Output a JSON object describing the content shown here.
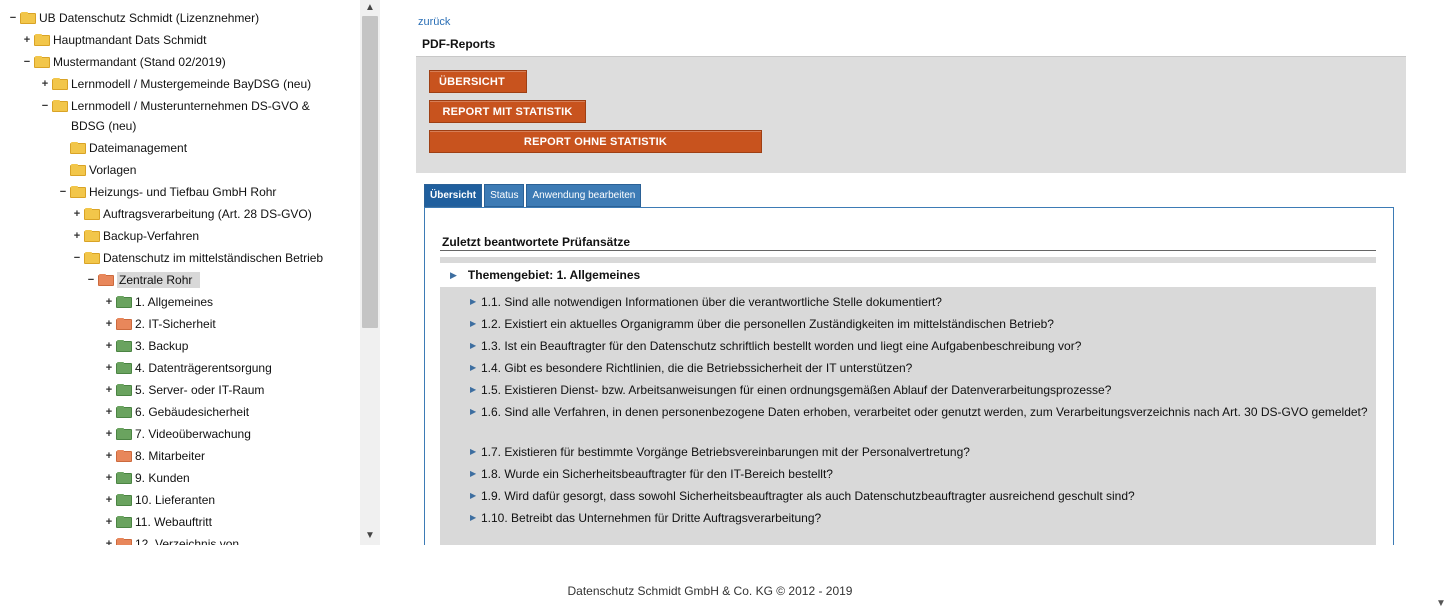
{
  "tree": {
    "items": [
      {
        "toggle": "−",
        "folder": "yellow",
        "label": "UB Datenschutz Schmidt (Lizenznehmer)"
      },
      {
        "toggle": "+",
        "folder": "yellow",
        "label": "Hauptmandant Dats Schmidt"
      },
      {
        "toggle": "−",
        "folder": "yellow",
        "label": "Mustermandant (Stand 02/2019)"
      },
      {
        "toggle": "+",
        "folder": "yellow",
        "label": "Lernmodell / Mustergemeinde BayDSG (neu)"
      },
      {
        "toggle": "−",
        "folder": "yellow",
        "label": "Lernmodell / Musterunternehmen DS-GVO & BDSG (neu)"
      },
      {
        "toggle": "",
        "folder": "yellow",
        "label": "Dateimanagement"
      },
      {
        "toggle": "",
        "folder": "yellow",
        "label": "Vorlagen"
      },
      {
        "toggle": "−",
        "folder": "yellow",
        "label": "Heizungs- und Tiefbau GmbH Rohr"
      },
      {
        "toggle": "+",
        "folder": "yellow",
        "label": "Auftragsverarbeitung (Art. 28 DS-GVO)"
      },
      {
        "toggle": "+",
        "folder": "yellow",
        "label": "Backup-Verfahren"
      },
      {
        "toggle": "−",
        "folder": "yellow",
        "label": "Datenschutz im mittelständischen Betrieb"
      },
      {
        "toggle": "−",
        "folder": "orange",
        "label": "Zentrale Rohr"
      },
      {
        "toggle": "+",
        "folder": "green",
        "label": "1. Allgemeines"
      },
      {
        "toggle": "+",
        "folder": "orange",
        "label": "2. IT-Sicherheit"
      },
      {
        "toggle": "+",
        "folder": "green",
        "label": "3. Backup"
      },
      {
        "toggle": "+",
        "folder": "green",
        "label": "4. Datenträgerentsorgung"
      },
      {
        "toggle": "+",
        "folder": "green",
        "label": "5. Server- oder IT-Raum"
      },
      {
        "toggle": "+",
        "folder": "green",
        "label": "6. Gebäudesicherheit"
      },
      {
        "toggle": "+",
        "folder": "green",
        "label": "7. Videoüberwachung"
      },
      {
        "toggle": "+",
        "folder": "orange",
        "label": "8. Mitarbeiter"
      },
      {
        "toggle": "+",
        "folder": "green",
        "label": "9. Kunden"
      },
      {
        "toggle": "+",
        "folder": "green",
        "label": "10. Lieferanten"
      },
      {
        "toggle": "+",
        "folder": "green",
        "label": "11. Webauftritt"
      },
      {
        "toggle": "+",
        "folder": "orange",
        "label": "12. Verzeichnis von"
      }
    ],
    "scroll_up": "▲",
    "scroll_down": "▼"
  },
  "content": {
    "back_link": "zurück",
    "reports_title": "PDF-Reports",
    "buttons": {
      "overview": "ÜBERSICHT",
      "with_stats": "REPORT MIT STATISTIK",
      "without_stats": "REPORT OHNE STATISTIK"
    },
    "tabs": [
      "Übersicht",
      "Status",
      "Anwendung bearbeiten"
    ],
    "section_title": "Zuletzt beantwortete Prüfansätze",
    "theme_title": "Themengebiet: 1. Allgemeines",
    "questions": [
      "1.1. Sind alle notwendigen Informationen über die verantwortliche Stelle dokumentiert?",
      "1.2. Existiert ein aktuelles Organigramm über die personellen Zuständigkeiten im mittelständischen Betrieb?",
      "1.3. Ist ein Beauftragter für den Datenschutz schriftlich bestellt worden und liegt eine Aufgabenbeschreibung vor?",
      "1.4. Gibt es besondere Richtlinien, die die Betriebssicherheit der IT unterstützen?",
      "1.5. Existieren Dienst- bzw. Arbeitsanweisungen für einen ordnungsgemäßen Ablauf der Datenverarbeitungsprozesse?",
      "1.6. Sind alle Verfahren, in denen personenbezogene Daten erhoben, verarbeitet oder genutzt werden, zum Verarbeitungsverzeichnis nach Art. 30 DS-GVO gemeldet?",
      "1.7. Existieren für bestimmte Vorgänge Betriebsvereinbarungen mit der Personalvertretung?",
      "1.8. Wurde ein Sicherheitsbeauftragter für den IT-Bereich bestellt?",
      "1.9. Wird dafür gesorgt, dass sowohl Sicherheitsbeauftragter als auch Datenschutzbeauftragter ausreichend geschult sind?",
      "1.10. Betreibt das Unternehmen für Dritte Auftragsverarbeitung?"
    ]
  },
  "footer": "Datenschutz Schmidt GmbH & Co. KG © 2012 - 2019",
  "page_scroll_down": "▼"
}
